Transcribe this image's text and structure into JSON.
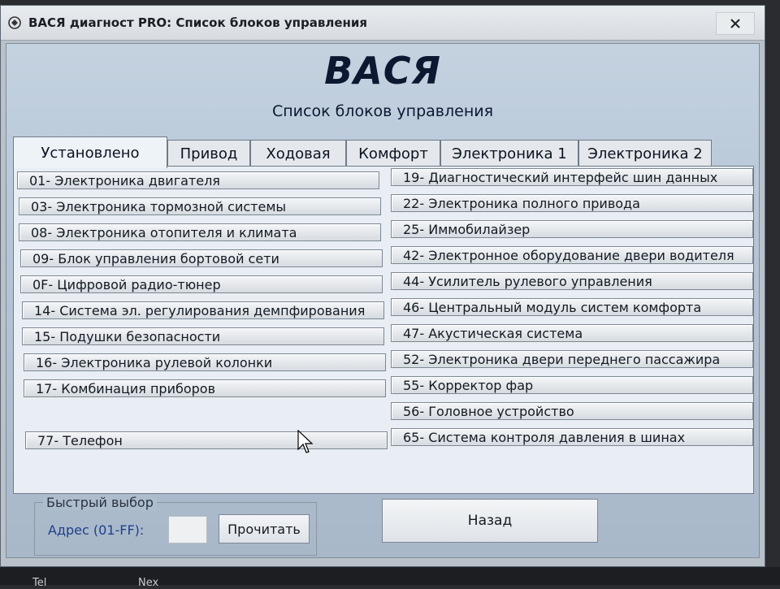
{
  "window": {
    "title": "ВАСЯ диагност PRO: Список блоков управления",
    "close_label": "✕"
  },
  "header": {
    "app_name": "ВАСЯ",
    "subtitle": "Список блоков управления"
  },
  "tabs": [
    {
      "label": "Установлено",
      "active": true
    },
    {
      "label": "Привод",
      "active": false
    },
    {
      "label": "Ходовая",
      "active": false
    },
    {
      "label": "Комфорт",
      "active": false
    },
    {
      "label": "Электроника 1",
      "active": false
    },
    {
      "label": "Электроника 2",
      "active": false
    }
  ],
  "modules_left": [
    "01- Электроника двигателя",
    "03- Электроника тормозной системы",
    "08- Электроника отопителя и климата",
    "09- Блок управления бортовой сети",
    "0F- Цифровой радио-тюнер",
    "14- Система эл. регулирования демпфирования",
    "15- Подушки безопасности",
    "16- Электроника рулевой колонки",
    "17- Комбинация приборов",
    "",
    "77- Телефон"
  ],
  "modules_right": [
    "19- Диагностический интерфейс шин данных",
    "22- Электроника полного привода",
    "25- Иммобилайзер",
    "42- Электронное оборудование двери водителя",
    "44- Усилитель рулевого управления",
    "46- Центральный модуль систем комфорта",
    "47- Акустическая система",
    "52- Электроника двери переднего пассажира",
    "55- Корректор фар",
    "56- Головное устройство",
    "65- Система контроля давления в шинах"
  ],
  "quick_select": {
    "group_label": "Быстрый выбор",
    "address_label": "Адрес (01-FF):",
    "address_value": "",
    "read_button": "Прочитать"
  },
  "back_button": "Назад",
  "taskbar": {
    "left_label": "Tel",
    "right_label": "Nex"
  }
}
